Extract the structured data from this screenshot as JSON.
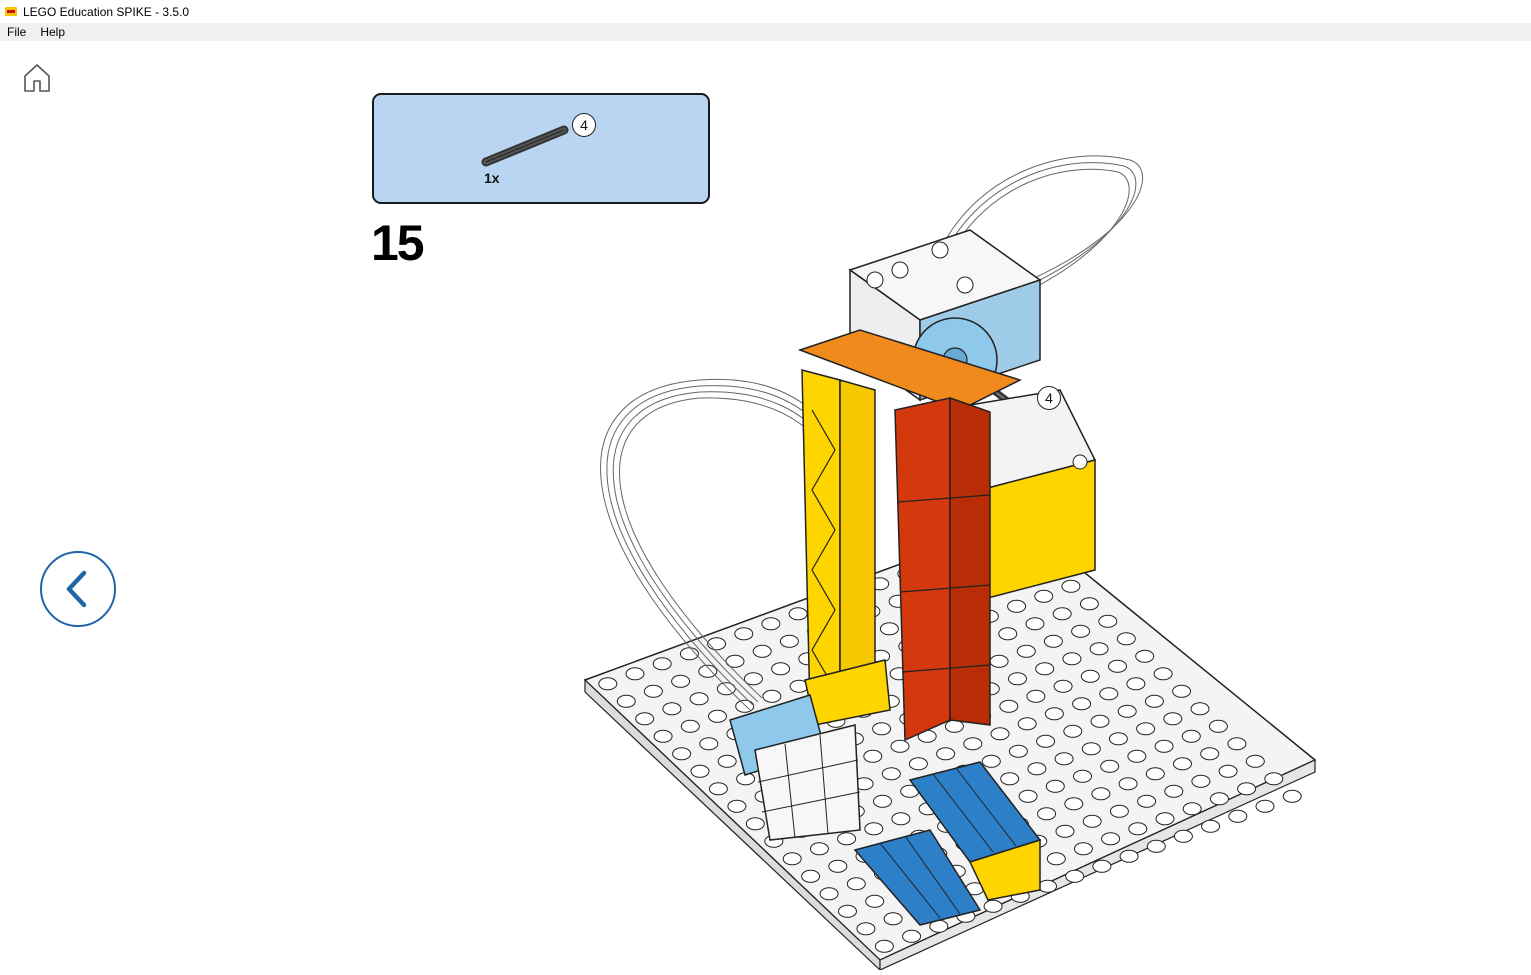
{
  "window": {
    "title": "LEGO Education SPIKE - 3.5.0"
  },
  "menu": {
    "items": [
      "File",
      "Help"
    ]
  },
  "nav": {
    "home_icon": "home-icon",
    "back_icon": "chevron-left-icon"
  },
  "instruction": {
    "step_number": "15",
    "parts_box": {
      "part_quantity": "1x",
      "part_length": "4"
    },
    "model_callout_length": "4"
  },
  "colors": {
    "parts_box_bg": "#bad5f2",
    "back_button": "#1f65a8",
    "lego_red": "#d4380d",
    "lego_yellow": "#ffd500",
    "lego_orange": "#f08a1c",
    "lego_blue": "#2d7fc8",
    "lego_light_blue": "#8ec8ea"
  }
}
